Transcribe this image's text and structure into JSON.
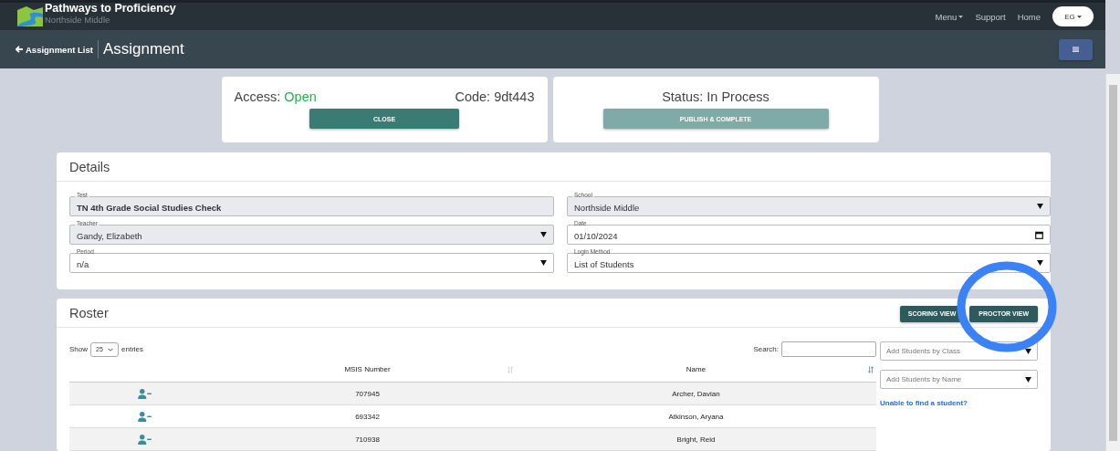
{
  "brand": {
    "title": "Pathways to Proficiency",
    "subtitle": "Northside Middle"
  },
  "nav": [
    {
      "label": "Menu",
      "kind": "dropdown"
    },
    {
      "label": "Support",
      "kind": "link"
    },
    {
      "label": "Home",
      "kind": "link"
    }
  ],
  "user": {
    "initials": "EG"
  },
  "header": {
    "back": "Assignment List",
    "title": "Assignment"
  },
  "access": {
    "label": "Access:",
    "value": "Open",
    "code": "Code: 9dt443",
    "button": {
      "label": "CLOSE",
      "disabled": false
    }
  },
  "status": {
    "text": "Status: In Process",
    "button": {
      "label": "PUBLISH & COMPLETE",
      "disabled": true
    }
  },
  "details": {
    "title": "Details",
    "fields": [
      {
        "label": "Test",
        "value": "TN 4th Grade Social Studies Check",
        "kind": "text",
        "disabled": true
      },
      {
        "label": "School",
        "value": "Northside Middle",
        "kind": "select",
        "disabled": true
      },
      {
        "label": "Teacher",
        "value": "Gandy, Elizabeth",
        "kind": "select",
        "disabled": true
      },
      {
        "label": "Date",
        "value": "01/10/2024",
        "kind": "date",
        "disabled": false
      },
      {
        "label": "Period",
        "value": "n/a",
        "kind": "select",
        "disabled": false
      },
      {
        "label": "Login Method",
        "value": "List of Students",
        "kind": "select",
        "disabled": false
      }
    ]
  },
  "roster": {
    "title": "Roster",
    "buttons": [
      {
        "label": "SCORING VIEW",
        "highlighted": false
      },
      {
        "label": "PROCTOR VIEW",
        "highlighted": true
      }
    ],
    "show": "Show",
    "page_size": "25",
    "entries": "entries",
    "search_label": "Search:",
    "columns": [
      {
        "label": "MSIS Number",
        "sorted": false
      },
      {
        "label": "Name",
        "sorted": true
      }
    ],
    "rows": [
      {
        "msis": "707945",
        "name": "Archer, Davian"
      },
      {
        "msis": "693342",
        "name": "Atkinson, Aryana"
      },
      {
        "msis": "710938",
        "name": "Bright, Reid"
      }
    ],
    "add_by_class": {
      "placeholder": "Add Students by Class"
    },
    "add_by_name": {
      "placeholder": "Add Students by Name"
    },
    "help_link": "Unable to find a student?"
  }
}
